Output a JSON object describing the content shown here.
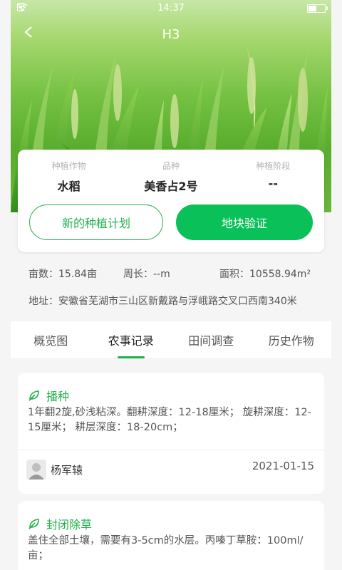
{
  "status_bar": {
    "time": "14:37",
    "battery_level": 0.5
  },
  "nav": {
    "title": "H3"
  },
  "crop_card": {
    "stats": [
      {
        "label": "种植作物",
        "value": "水稻"
      },
      {
        "label": "品种",
        "value": "美香占2号"
      },
      {
        "label": "种植阶段",
        "value": "--"
      }
    ],
    "new_plan_label": "新的种植计划",
    "verify_label": "地块验证"
  },
  "field_info": {
    "area_mu": "亩数：15.84亩",
    "perimeter": "周长：--m",
    "area_m2": "面积：10558.94m²",
    "address": "地址：安徽省芜湖市三山区新戴路与浮峨路交叉口西南340米"
  },
  "tabs": [
    {
      "label": "概览图"
    },
    {
      "label": "农事记录"
    },
    {
      "label": "田间调查"
    },
    {
      "label": "历史作物"
    }
  ],
  "records": [
    {
      "title": "播种",
      "description": "1年翻2旋,砂浅粘深。翻耕深度：12-18厘米； 旋耕深度：12-15厘米； 耕层深度：18-20cm；",
      "user": "杨军辕",
      "date": "2021-01-15"
    },
    {
      "title": "封闭除草",
      "description": "盖住全部土壤，需要有3-5cm的水层。丙嗪丁草胺：100ml/亩；"
    }
  ],
  "colors": {
    "accent": "#22b14c",
    "button_fill": "#0ac058"
  },
  "icons": [
    "back-arrow-icon",
    "leaf-icon",
    "user-avatar-icon",
    "wifi-icon",
    "sim-icon",
    "battery-icon"
  ]
}
